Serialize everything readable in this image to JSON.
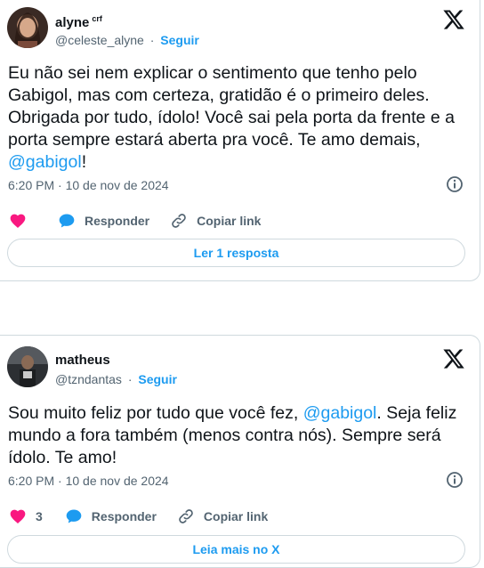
{
  "tweets": [
    {
      "author_name": "alyne",
      "author_badge": "crf",
      "handle": "@celeste_alyne",
      "separator": "·",
      "follow_label": "Seguir",
      "text_before": "Eu não sei nem explicar o sentimento que tenho pelo Gabigol, mas com certeza, gratidão é o primeiro deles. Obrigada por tudo, ídolo! Você sai pela porta da frente e a porta sempre estará aberta pra você. Te amo demais, ",
      "mention": "@gabigol",
      "text_after": "!",
      "timestamp": "6:20 PM · 10 de nov de 2024",
      "like_count": "",
      "reply_label": "Responder",
      "copy_label": "Copiar link",
      "bottom_button": "Ler 1 resposta"
    },
    {
      "author_name": "matheus",
      "handle": "@tzndantas",
      "separator": "·",
      "follow_label": "Seguir",
      "text_before": "Sou muito feliz por tudo que você fez, ",
      "mention": "@gabigol",
      "text_after": ". Seja feliz mundo a fora também (menos contra nós). Sempre será ídolo. Te amo!",
      "timestamp": "6:20 PM · 10 de nov de 2024",
      "like_count": "3",
      "reply_label": "Responder",
      "copy_label": "Copiar link",
      "bottom_button": "Leia mais no X"
    }
  ],
  "icons": {
    "like": "heart-icon",
    "reply": "speech-bubble-icon",
    "copy": "link-icon",
    "info": "info-icon",
    "brand": "x-logo-icon"
  },
  "colors": {
    "accent": "#1d9bf0",
    "like": "#f91880",
    "text": "#0f1419",
    "muted": "#536471",
    "border": "#cfd9de"
  }
}
